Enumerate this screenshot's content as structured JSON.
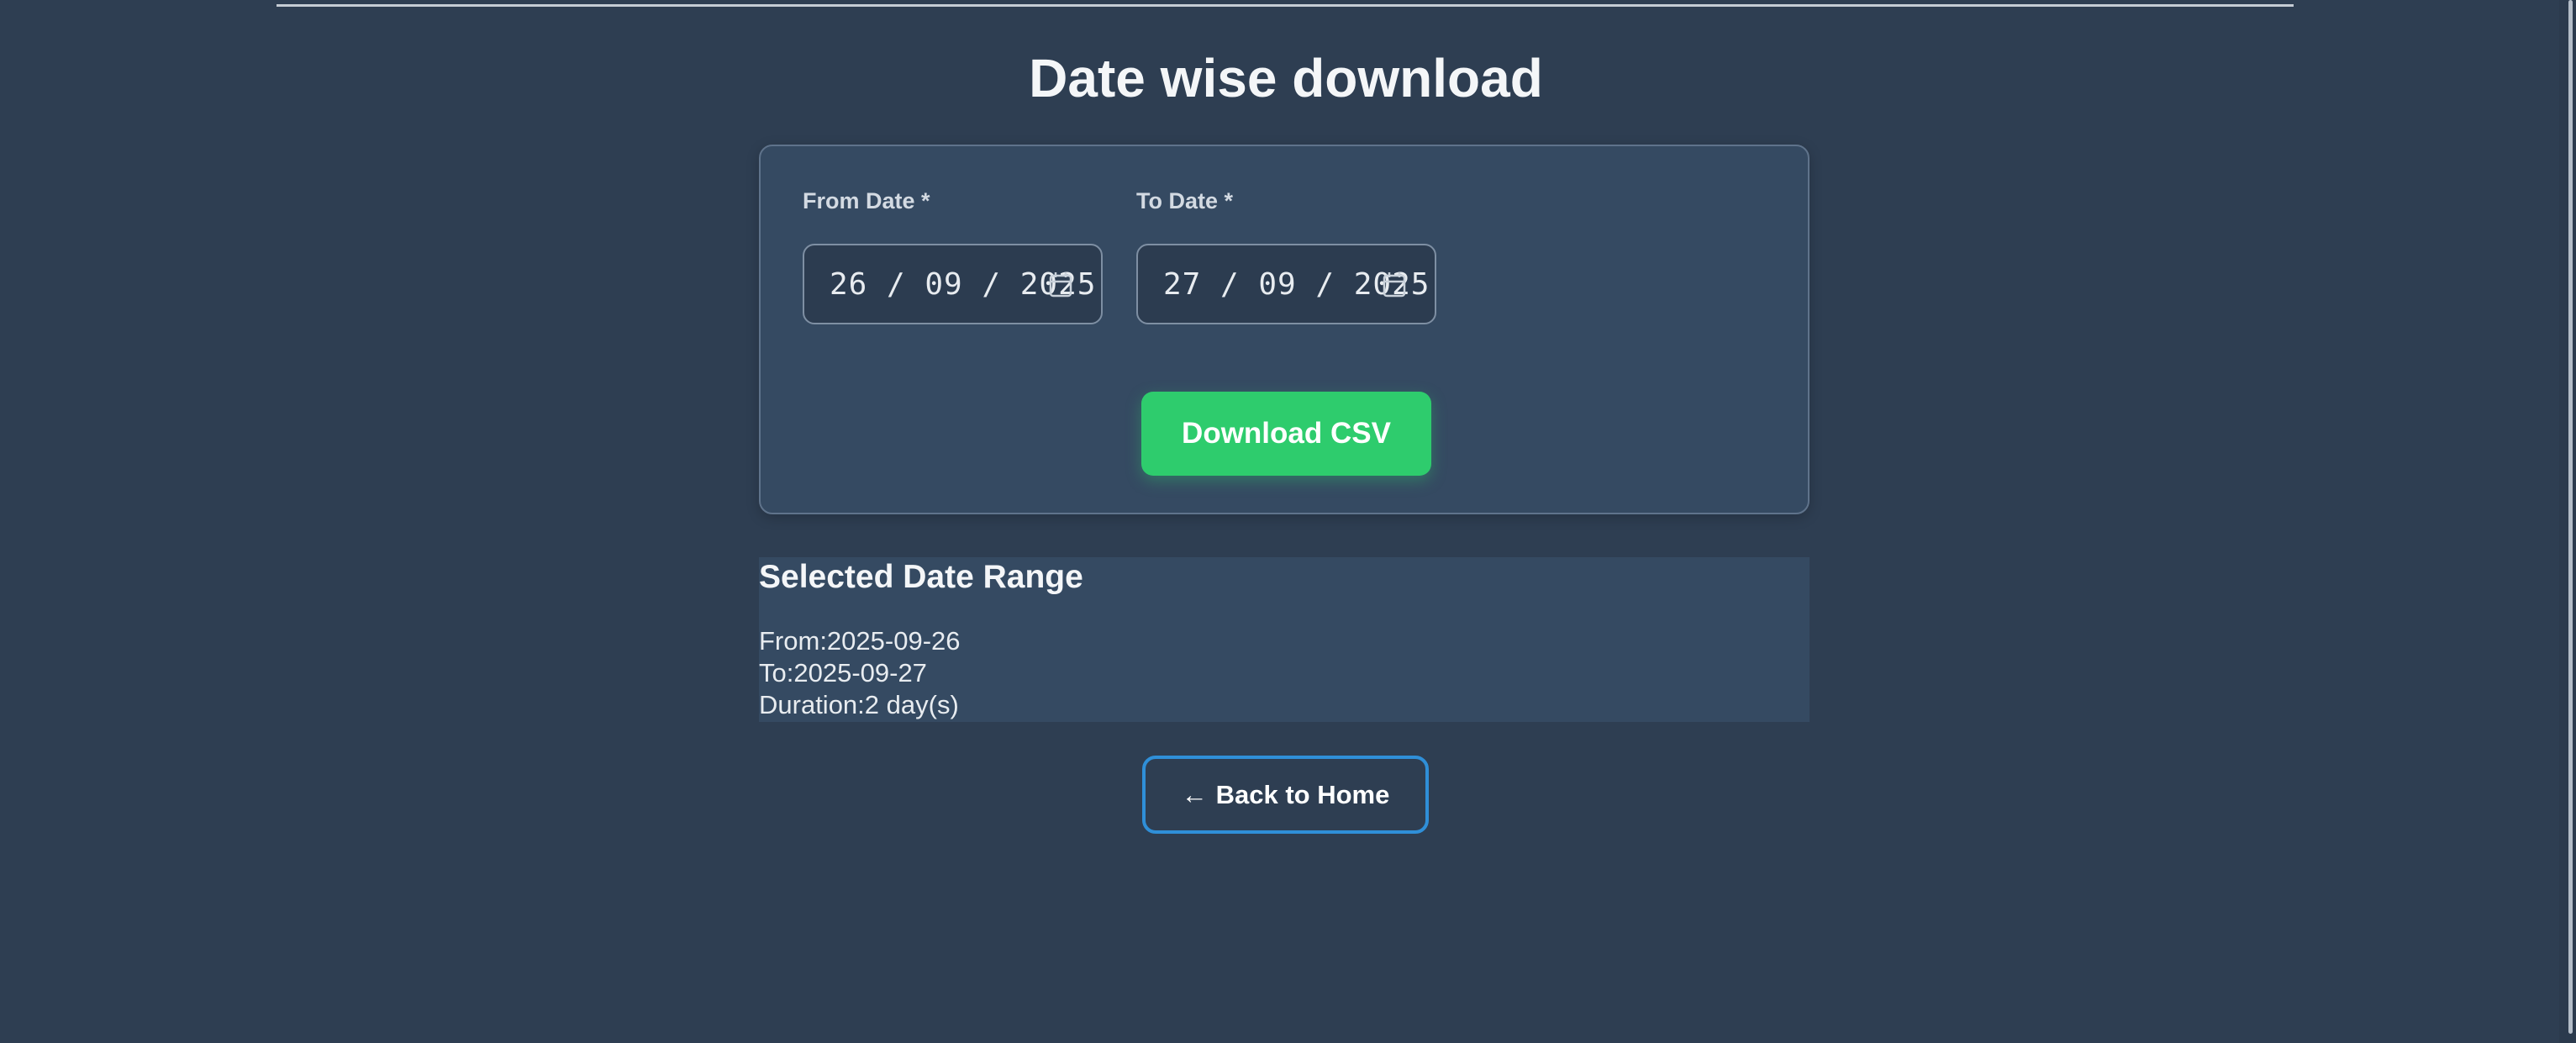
{
  "page": {
    "title": "Date wise download"
  },
  "form": {
    "from_label": "From Date *",
    "to_label": "To Date *",
    "from_value": "26 / 09 / 2025",
    "to_value": "27 / 09 / 2025",
    "download_label": "Download CSV"
  },
  "range": {
    "heading": "Selected Date Range",
    "from_text": "From:2025-09-26",
    "to_text": "To:2025-09-27",
    "duration_text": "Duration:2 day(s)"
  },
  "nav": {
    "back_arrow": "←",
    "back_label": "Back to Home"
  },
  "icons": {
    "from_calendar": "calendar-icon",
    "to_calendar": "calendar-icon",
    "back": "arrow-left-icon"
  },
  "colors": {
    "background": "#2e3e52",
    "card": "#354a62",
    "download_button": "#2ecc6d",
    "back_button_border": "#2f8fd8"
  }
}
